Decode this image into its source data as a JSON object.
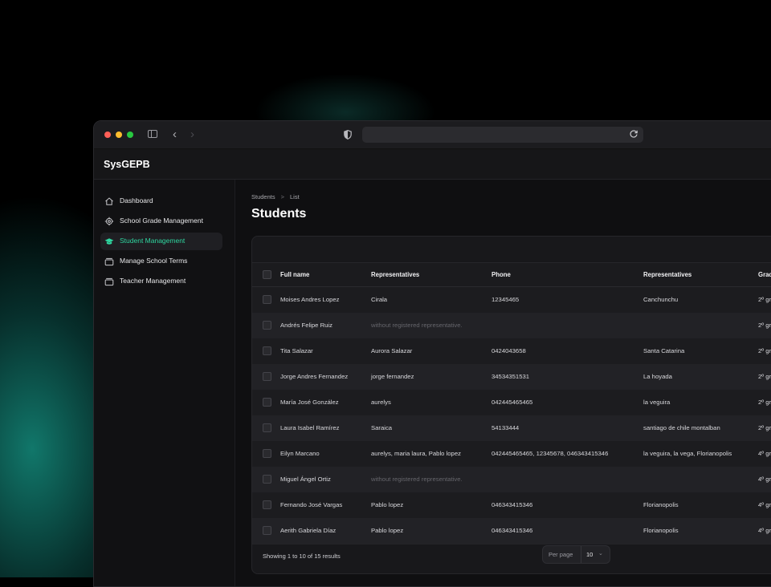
{
  "app": {
    "brand": "SysGEPB"
  },
  "sidebar": {
    "items": [
      {
        "label": "Dashboard",
        "icon": "home-icon",
        "active": false
      },
      {
        "label": "School Grade Management",
        "icon": "gear-icon",
        "active": false
      },
      {
        "label": "Student Management",
        "icon": "graduation-cap-icon",
        "active": true
      },
      {
        "label": "Manage School Terms",
        "icon": "folder-icon",
        "active": false
      },
      {
        "label": "Teacher Management",
        "icon": "folder-icon",
        "active": false
      }
    ]
  },
  "breadcrumb": {
    "items": [
      "Students",
      "List"
    ],
    "separator": ">"
  },
  "page": {
    "title": "Students"
  },
  "table": {
    "columns": [
      "Full name",
      "Representatives",
      "Phone",
      "Representatives",
      "Grac"
    ],
    "rows": [
      {
        "name": "Moises Andres Lopez",
        "representatives": "Cirala",
        "phone": "12345465",
        "address": "Canchunchu",
        "grade": "2º gr"
      },
      {
        "name": "Andrés Felipe Ruiz",
        "representatives": "without registered representative.",
        "phone": "",
        "address": "",
        "grade": "2º gr"
      },
      {
        "name": "Tita Salazar",
        "representatives": "Aurora Salazar",
        "phone": "0424043658",
        "address": "Santa Catarina",
        "grade": "2º gr"
      },
      {
        "name": "Jorge Andres Fernandez",
        "representatives": "jorge fernandez",
        "phone": "34534351531",
        "address": "La hoyada",
        "grade": "2º gr"
      },
      {
        "name": "María José González",
        "representatives": "aurelys",
        "phone": "042445465465",
        "address": "la veguira",
        "grade": "2º gr"
      },
      {
        "name": "Laura Isabel Ramírez",
        "representatives": "Saraica",
        "phone": "54133444",
        "address": "santiago de chile montalban",
        "grade": "2º gr"
      },
      {
        "name": "Eilyn Marcano",
        "representatives": "aurelys, maria laura, Pablo lopez",
        "phone": "042445465465, 12345678, 046343415346",
        "address": "la veguira, la vega, Florianopolis",
        "grade": "4º gr"
      },
      {
        "name": "Miguel Ángel Ortiz",
        "representatives": "without registered representative.",
        "phone": "",
        "address": "",
        "grade": "4º gr"
      },
      {
        "name": "Fernando José Vargas",
        "representatives": "Pablo lopez",
        "phone": "046343415346",
        "address": "Florianopolis",
        "grade": "4º gr"
      },
      {
        "name": "Aerith Gabriela Díaz",
        "representatives": "Pablo lopez",
        "phone": "046343415346",
        "address": "Florianopolis",
        "grade": "4º gr"
      }
    ],
    "footer": {
      "showing": "Showing 1 to 10 of 15 results",
      "per_page_label": "Per page",
      "per_page_value": "10"
    }
  },
  "colors": {
    "accent": "#2fd6a0",
    "glow": "#148c7d"
  }
}
